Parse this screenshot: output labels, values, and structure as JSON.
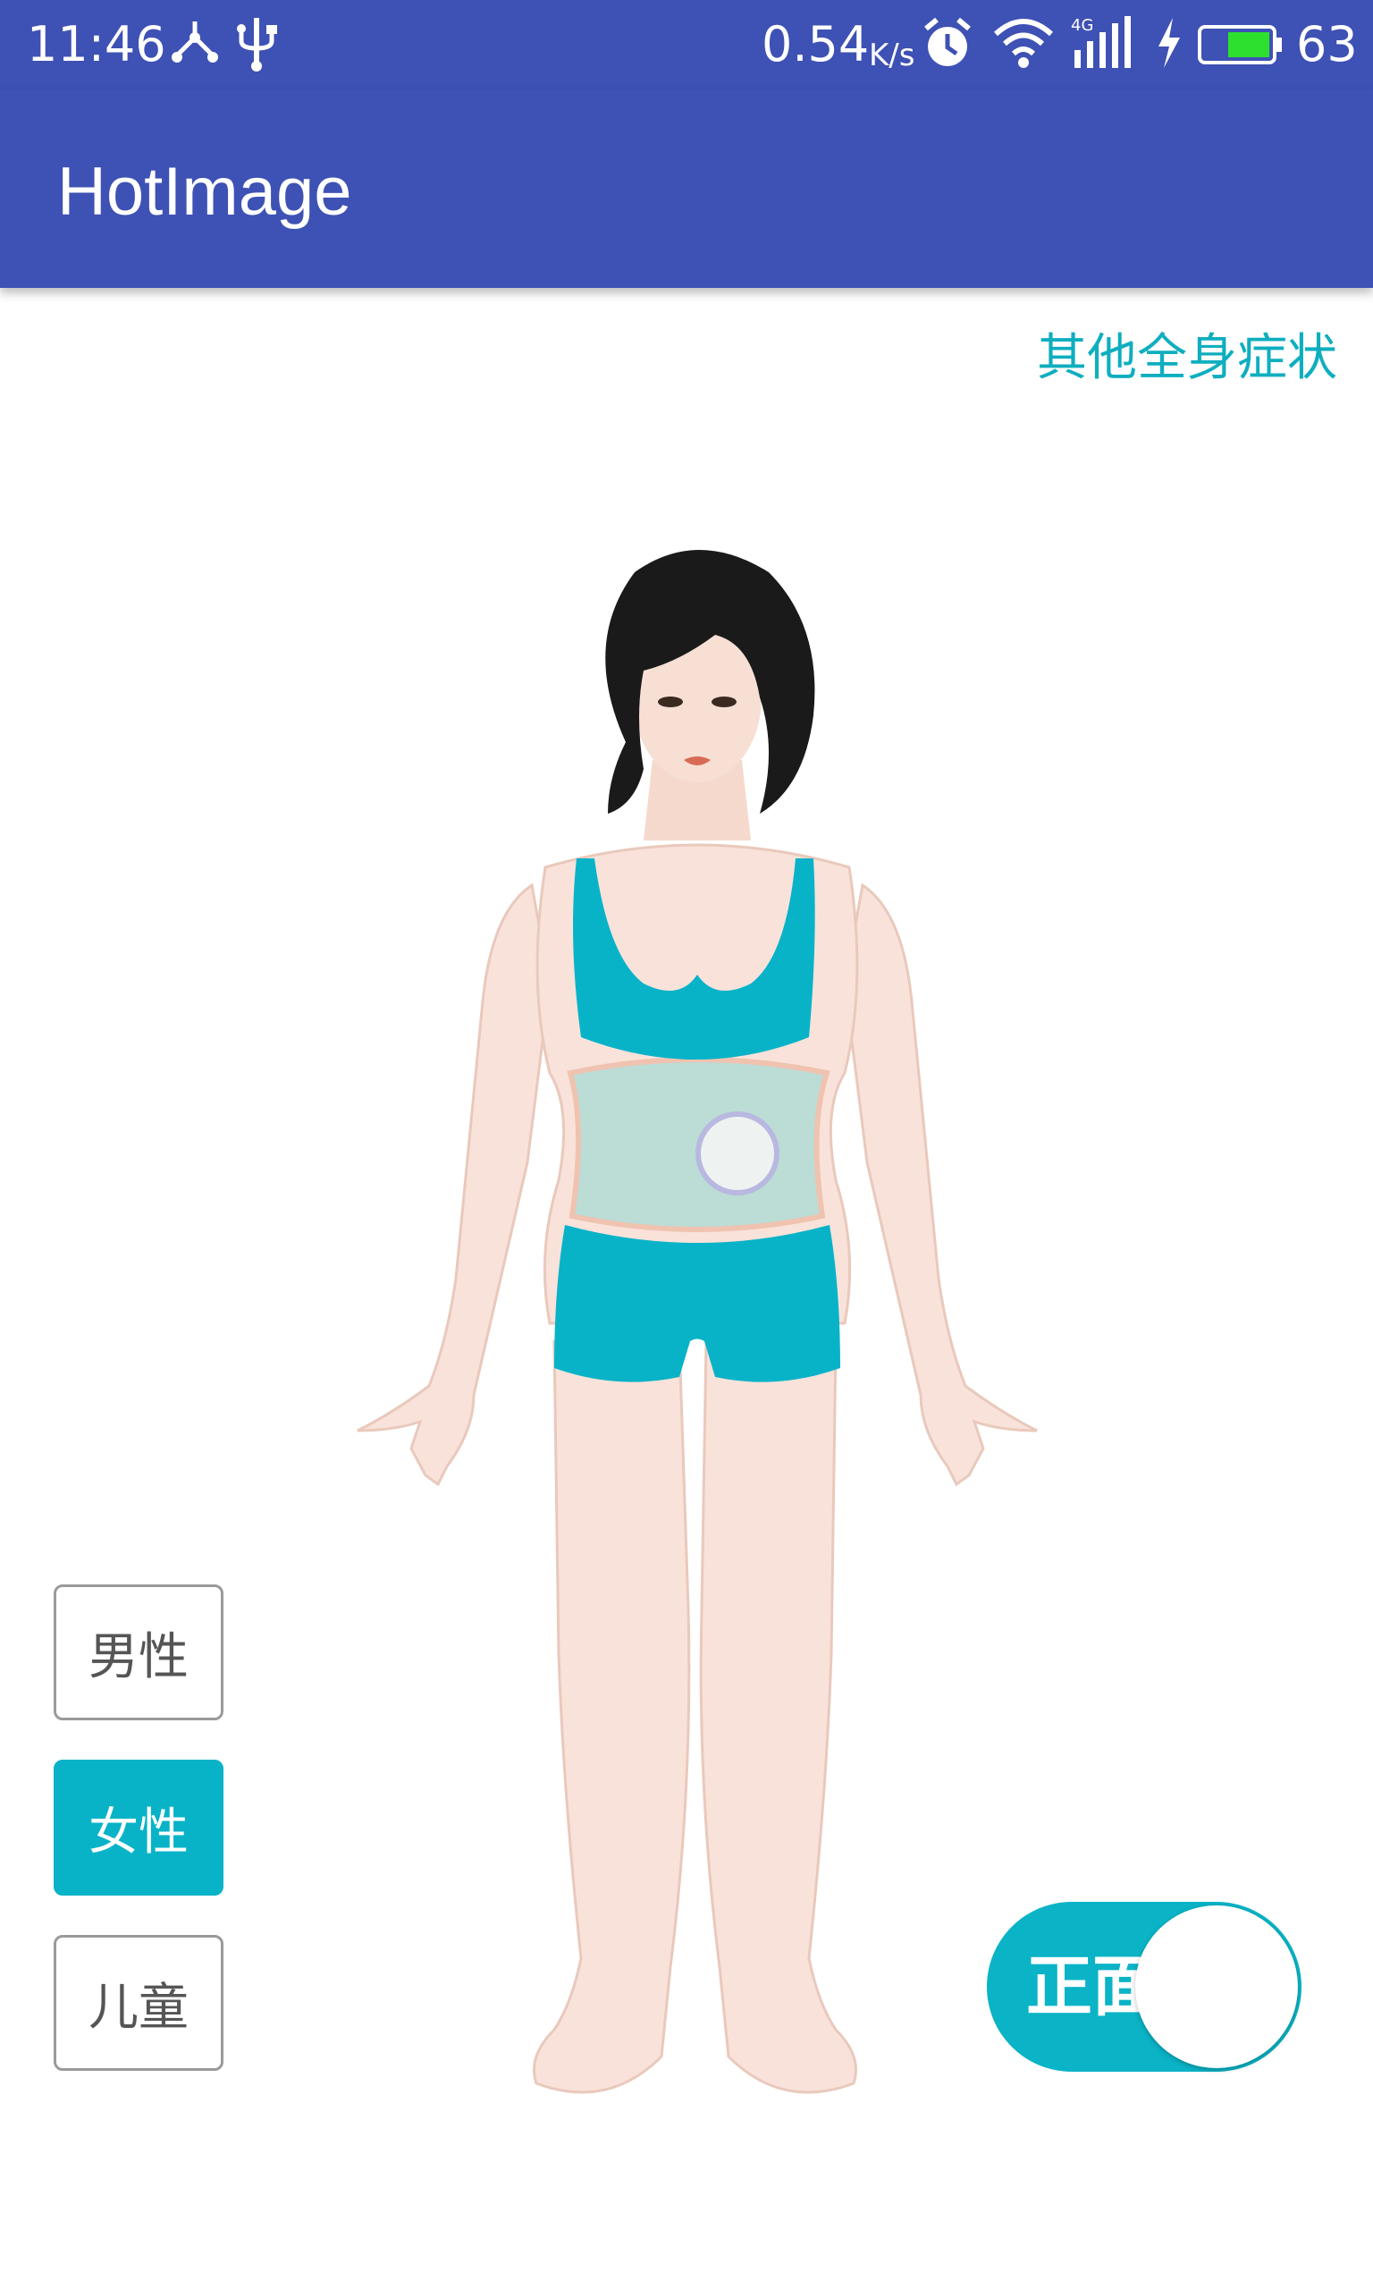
{
  "status_bar": {
    "time": "11:46",
    "net_speed": "0.54",
    "net_speed_unit": "K/s",
    "battery": "63",
    "icons": [
      "usb-tether-icon",
      "usb-icon",
      "alarm-icon",
      "wifi-icon",
      "signal-4g-icon",
      "charging-icon",
      "battery-icon"
    ]
  },
  "app_bar": {
    "title": "HotImage"
  },
  "main": {
    "other_symptoms_link": "其他全身症状",
    "hotspot_region": "abdomen",
    "categories": [
      {
        "label": "男性",
        "selected": false
      },
      {
        "label": "女性",
        "selected": true
      },
      {
        "label": "儿童",
        "selected": false
      }
    ],
    "view_toggle": {
      "label": "正面",
      "on": true
    }
  },
  "colors": {
    "primary": "#3e51b4",
    "accent": "#0ab3c6",
    "border": "#9a9a9a"
  }
}
